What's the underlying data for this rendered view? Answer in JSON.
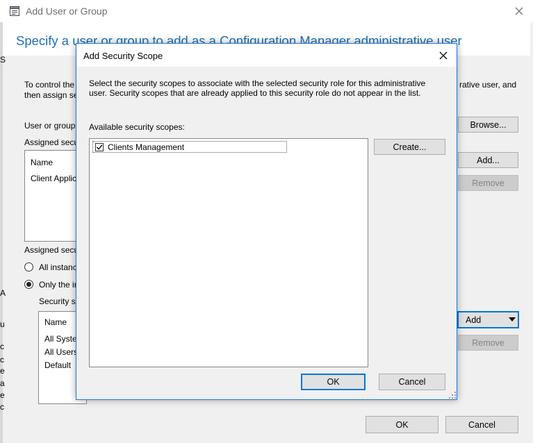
{
  "outer": {
    "title": "Add User or Group",
    "heading": "Specify a user or group to add as a Configuration Manager administrative user",
    "intro_left_1": "To control the",
    "intro_left_2": "then assign se",
    "intro_right": "rative user, and",
    "user_group_label": "User or group",
    "browse_label": "Browse...",
    "assigned_roles_label": "Assigned secu",
    "roles_header": "Name",
    "roles_row": "Client Applic",
    "add_role_label": "Add...",
    "remove_role_label": "Remove",
    "assigned_scopes_label": "Assigned secu",
    "radio_all": "All instanc",
    "radio_only": "Only the ir",
    "security_scopes_label": "Security sc",
    "scopes_header": "Name",
    "scopes_rows": [
      "All Syste",
      "All Users",
      "Default"
    ],
    "add_dropdown_label": "Add",
    "remove_scope_label": "Remove",
    "ok_label": "OK",
    "cancel_label": "Cancel",
    "left_edge_chars": [
      "S",
      "A",
      "u",
      "c",
      "c",
      "e",
      "a",
      "e",
      "c"
    ]
  },
  "modal": {
    "title": "Add Security Scope",
    "description": "Select the security scopes to associate with the selected security role for this administrative user.  Security scopes that are already applied to this security role do not appear in the list.",
    "list_label": "Available security scopes:",
    "items": [
      {
        "label": "Clients Management",
        "checked": true
      }
    ],
    "create_label": "Create...",
    "ok_label": "OK",
    "cancel_label": "Cancel"
  },
  "colors": {
    "accent": "#0078d7",
    "heading": "#1f6fb5",
    "window_bg": "#f0f0f0"
  }
}
